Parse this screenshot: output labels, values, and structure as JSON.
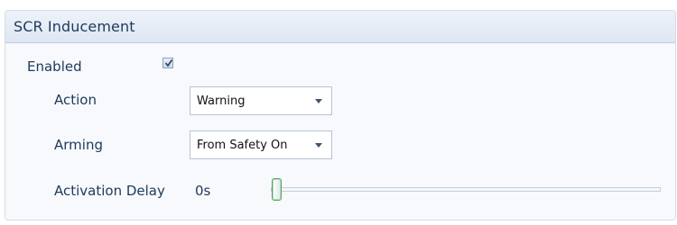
{
  "panel": {
    "title": "SCR Inducement"
  },
  "enabled": {
    "label": "Enabled",
    "checked": true
  },
  "action": {
    "label": "Action",
    "value": "Warning"
  },
  "arming": {
    "label": "Arming",
    "value": "From Safety On"
  },
  "activation_delay": {
    "label": "Activation Delay",
    "value": "0s",
    "slider_fraction": 0
  },
  "icons": {
    "checkbox": "checkmark-icon",
    "dropdown": "chevron-down-icon"
  },
  "colors": {
    "text": "#1e395b",
    "header_bg": "#dde6f2",
    "panel_bg": "#f7f9fc",
    "slider_thumb_border": "#57a05a"
  }
}
